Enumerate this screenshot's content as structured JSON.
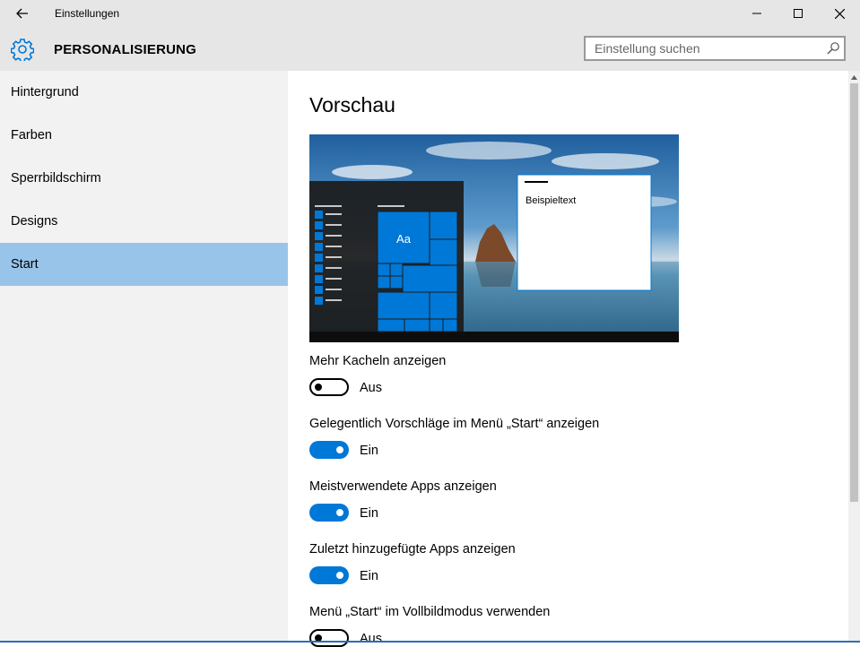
{
  "window": {
    "title": "Einstellungen"
  },
  "header": {
    "section": "PERSONALISIERUNG",
    "search_placeholder": "Einstellung suchen"
  },
  "sidebar": {
    "items": [
      {
        "label": "Hintergrund"
      },
      {
        "label": "Farben"
      },
      {
        "label": "Sperrbildschirm"
      },
      {
        "label": "Designs"
      },
      {
        "label": "Start",
        "active": true
      }
    ]
  },
  "main": {
    "heading": "Vorschau",
    "preview": {
      "tile_text": "Aa",
      "sample_text": "Beispieltext"
    },
    "settings": [
      {
        "label": "Mehr Kacheln anzeigen",
        "state": "Aus",
        "on": false
      },
      {
        "label": "Gelegentlich Vorschläge im Menü „Start“ anzeigen",
        "state": "Ein",
        "on": true
      },
      {
        "label": "Meistverwendete Apps anzeigen",
        "state": "Ein",
        "on": true
      },
      {
        "label": "Zuletzt hinzugefügte Apps anzeigen",
        "state": "Ein",
        "on": true
      },
      {
        "label": "Menü „Start“ im Vollbildmodus verwenden",
        "state": "Aus",
        "on": false
      }
    ]
  },
  "colors": {
    "accent": "#0078d7",
    "selected": "#99c4ea",
    "chrome": "#e6e6e6",
    "sidebar": "#f2f2f2"
  },
  "icons": [
    "back-arrow-icon",
    "minimize-icon",
    "maximize-icon",
    "close-icon",
    "gear-icon",
    "search-icon"
  ]
}
